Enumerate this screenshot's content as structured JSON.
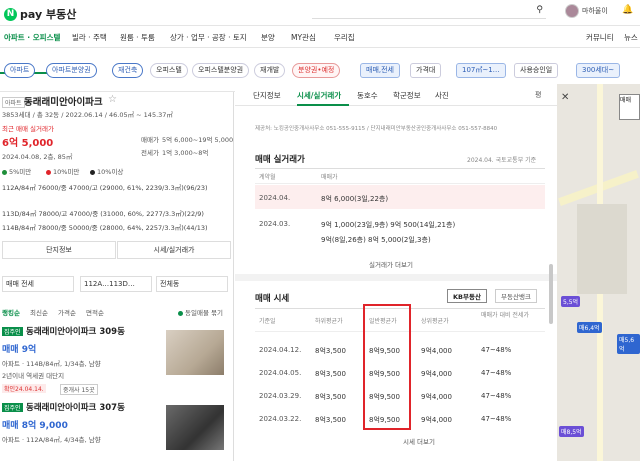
{
  "header": {
    "logo_n": "N",
    "logo_text": "pay 부동산",
    "user_name": "마하울이"
  },
  "nav": {
    "items": [
      "아파트 · 오피스텔",
      "빌라 · 주택",
      "원룸 · 투룸",
      "상가 · 업무 · 공장 · 토지",
      "분양",
      "MY관심",
      "우리집",
      "커뮤니티",
      "뉴스"
    ]
  },
  "filters": {
    "row1": [
      "아파트",
      "아파트분양권",
      "재건축",
      "오피스텔",
      "오피스텔분양권",
      "재개발",
      "분양권•예정",
      "매매,전세",
      "가격대",
      "107㎡~1…",
      "사용승인일",
      "300세대~"
    ]
  },
  "left": {
    "badge": "아파트",
    "title": "동래래미안아이파크",
    "sub": "3853세대 / 총 32동 / 2022.06.14 / 46.05㎡ ~ 145.37㎡",
    "recent_label": "최근 매매 실거래가",
    "recent_price": "6억 5,000",
    "recent_date": "2024.04.08, 2층, 85㎡",
    "sale_range_label": "매매가",
    "sale_range": "5억 6,000~19억 5,000",
    "jeonse_range_label": "전세가",
    "jeonse_range": "1억 3,000~8억",
    "legend": [
      "5%미만",
      "10%미만",
      "10%이상"
    ],
    "rows": [
      "112A/84㎡ 76000/중 47000/고 (29000, 61%, 2239/3.3㎡)(96/23)",
      "113D/84㎡ 78000/고 47000/중 (31000, 60%, 2277/3.3㎡)(22/9)",
      "114B/84㎡ 78000/중 50000/중 (28000, 64%, 2257/3.3㎡)(44/13)"
    ],
    "btn_info": "단지정보",
    "btn_price": "시세/실거래가",
    "select1": "매매 전세",
    "select2": "112A…113D…",
    "select3": "전체동",
    "sort": [
      "랭킹순",
      "최신순",
      "가격순",
      "면적순"
    ],
    "same_group": "동일매물 묶기",
    "listings": [
      {
        "badge": "집주인",
        "title": "동래래미안아이파크 309동",
        "price": "매매 9억",
        "desc1": "아파트 · 114B/84㎡, 1/34층, 남향",
        "desc2": "2년이내  역세권  대단지",
        "confirm": "확인24.04.14.",
        "agents": "중개사 15곳"
      },
      {
        "badge": "집주인",
        "title": "동래래미안아이파크 307동",
        "price": "매매 8억 9,000",
        "desc1": "아파트 · 112A/84㎡, 4/34층, 남향"
      }
    ]
  },
  "mid": {
    "tabs": [
      "단지정보",
      "시세/실거래가",
      "동호수",
      "학군정보",
      "사진"
    ],
    "agency_note": "제공처: 노킹공인중개사사무소 051-555-9115 / 단지내래미안부동산공인중개사사무소 051-557-8840",
    "trade_title": "매매 실거래가",
    "trade_source": "2024.04. 국토교통부 기준",
    "trade_head": [
      "계약월",
      "매매가"
    ],
    "trades": [
      {
        "month": "2024.04.",
        "price": "8억 6,000(3일,22층)"
      },
      {
        "month": "2024.03.",
        "price": "9억 1,000(23일,9층)   9억 500(14일,21층)"
      },
      {
        "month": "",
        "price": "9억(8일,26층)   8억 5,000(2일,3층)"
      }
    ],
    "trade_more": "실거래가 더보기",
    "market_title": "매매 시세",
    "market_tabs": [
      "KB부동산",
      "부동산뱅크"
    ],
    "market_head": [
      "기준일",
      "하위평균가",
      "일반평균가",
      "상위평균가",
      "매매가 대비 전세가"
    ],
    "markets": [
      {
        "date": "2024.04.12.",
        "low": "8억3,500",
        "avg": "8억9,500",
        "high": "9억4,000",
        "ratio": "47~48%"
      },
      {
        "date": "2024.04.05.",
        "low": "8억3,500",
        "avg": "8억9,500",
        "high": "9억4,000",
        "ratio": "47~48%"
      },
      {
        "date": "2024.03.29.",
        "low": "8억3,500",
        "avg": "8억9,500",
        "high": "9억4,000",
        "ratio": "47~48%"
      },
      {
        "date": "2024.03.22.",
        "low": "8억3,500",
        "avg": "8억9,500",
        "high": "9억4,000",
        "ratio": "47~48%"
      }
    ],
    "market_more": "시세 더보기",
    "close": "✕",
    "share": "평"
  },
  "map": {
    "markers": [
      "5,5억",
      "매6,4억",
      "매8,5억",
      "매5,6억"
    ],
    "pin": "매매"
  }
}
